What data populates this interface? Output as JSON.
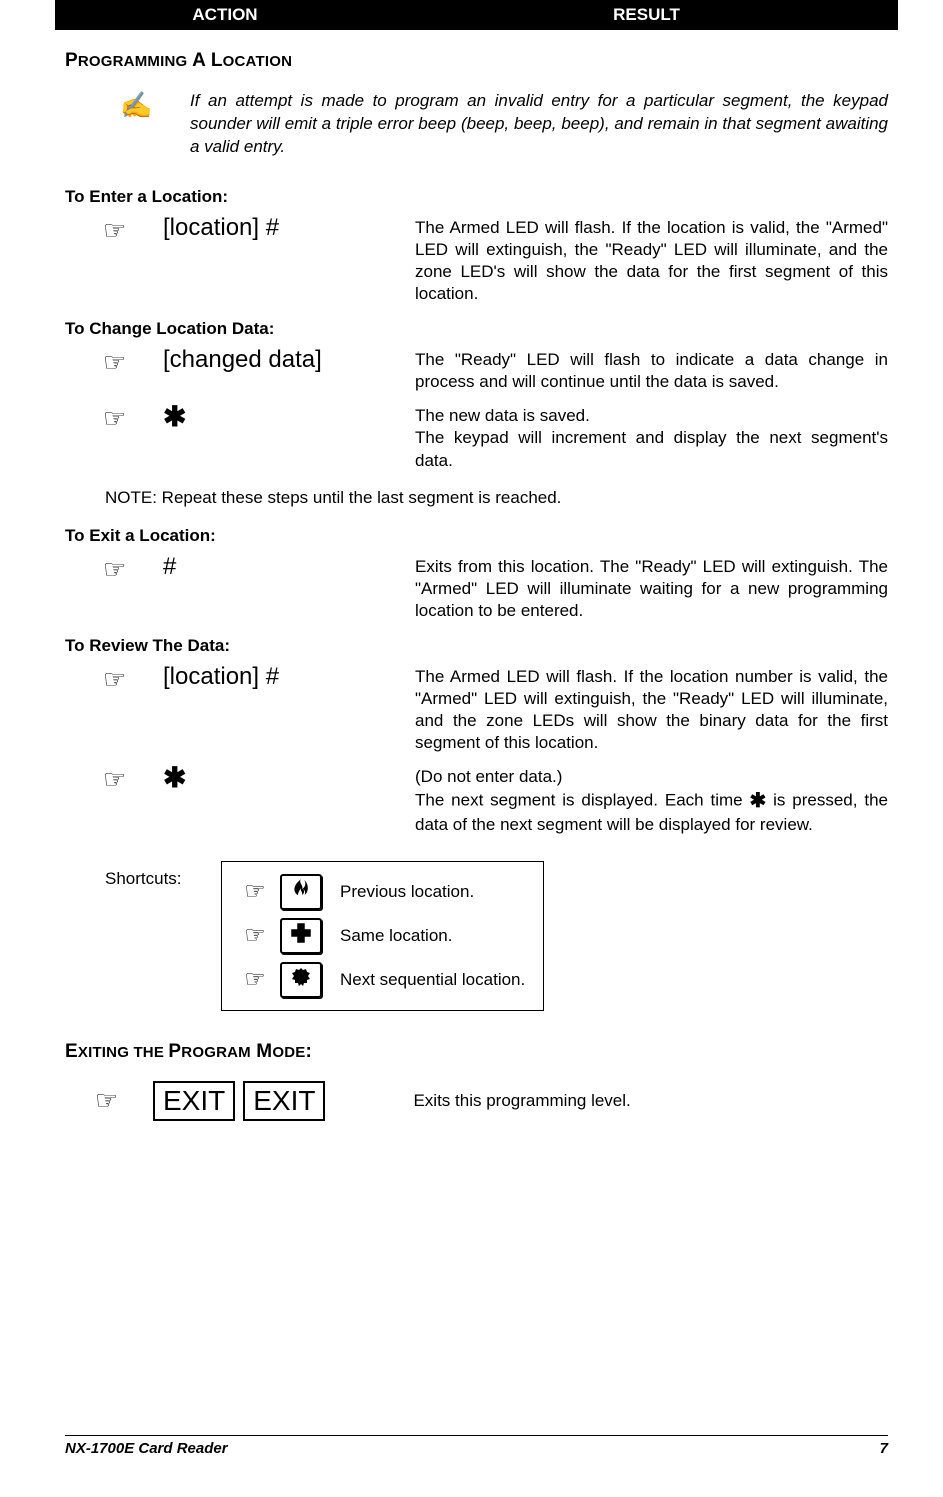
{
  "header": {
    "action": "ACTION",
    "result": "RESULT"
  },
  "section1": {
    "title_big1": "P",
    "title_small1": "ROGRAMMING",
    "title_big2": " A L",
    "title_small2": "OCATION",
    "note": "If an attempt is made to program an invalid entry for a particular segment, the keypad sounder will emit a triple error beep (beep, beep, beep), and remain in that segment awaiting a valid entry."
  },
  "enter": {
    "heading": "To Enter a Location:",
    "action": "[location]  #",
    "result": "The Armed LED will flash.  If the location is valid, the \"Armed\" LED will extinguish, the \"Ready\" LED will illuminate, and the zone LED's will show the data for the first segment of this location."
  },
  "change": {
    "heading": "To Change Location Data:",
    "action1": "[changed data]",
    "result1": "The \"Ready\" LED will flash to indicate a data change in process and will continue until the data is saved.",
    "action2": "✱",
    "result2a": "The new data is saved.",
    "result2b": "The keypad will increment and display the next segment's data.",
    "note": "NOTE:  Repeat these steps until the last segment is reached."
  },
  "exit": {
    "heading": "To Exit a Location:",
    "action": "#",
    "result": "Exits from this location.  The \"Ready\" LED will extinguish. The \"Armed\" LED will illuminate waiting for a new programming location to be entered."
  },
  "review": {
    "heading": "To Review The Data:",
    "action1": "[location] #",
    "result1": "The Armed LED will flash.  If the location number is valid, the \"Armed\" LED will extinguish, the \"Ready\" LED will illuminate, and the zone LEDs will show the binary data for the first segment of this location.",
    "action2": "✱",
    "result2_pre": "(Do not enter data.)",
    "result2a": "The next segment is displayed. Each time ",
    "result2b": " is pressed, the data of the next segment will be displayed for review."
  },
  "shortcuts": {
    "label": "Shortcuts:",
    "items": [
      {
        "icon": "flame",
        "text": "Previous location."
      },
      {
        "icon": "plus",
        "text": "Same location."
      },
      {
        "icon": "shield",
        "text": "Next sequential location."
      }
    ]
  },
  "exitmode": {
    "title_big1": "E",
    "title_small1": "XITING",
    "title_big2": " THE ",
    "title_small2": "",
    "title_big3": "P",
    "title_small3": "ROGRAM",
    "title_big4": " M",
    "title_small4": "ODE",
    "colon": ":",
    "btn": "EXIT",
    "result": "Exits this programming level."
  },
  "footer": {
    "left": "NX-1700E Card Reader",
    "right": "7"
  }
}
